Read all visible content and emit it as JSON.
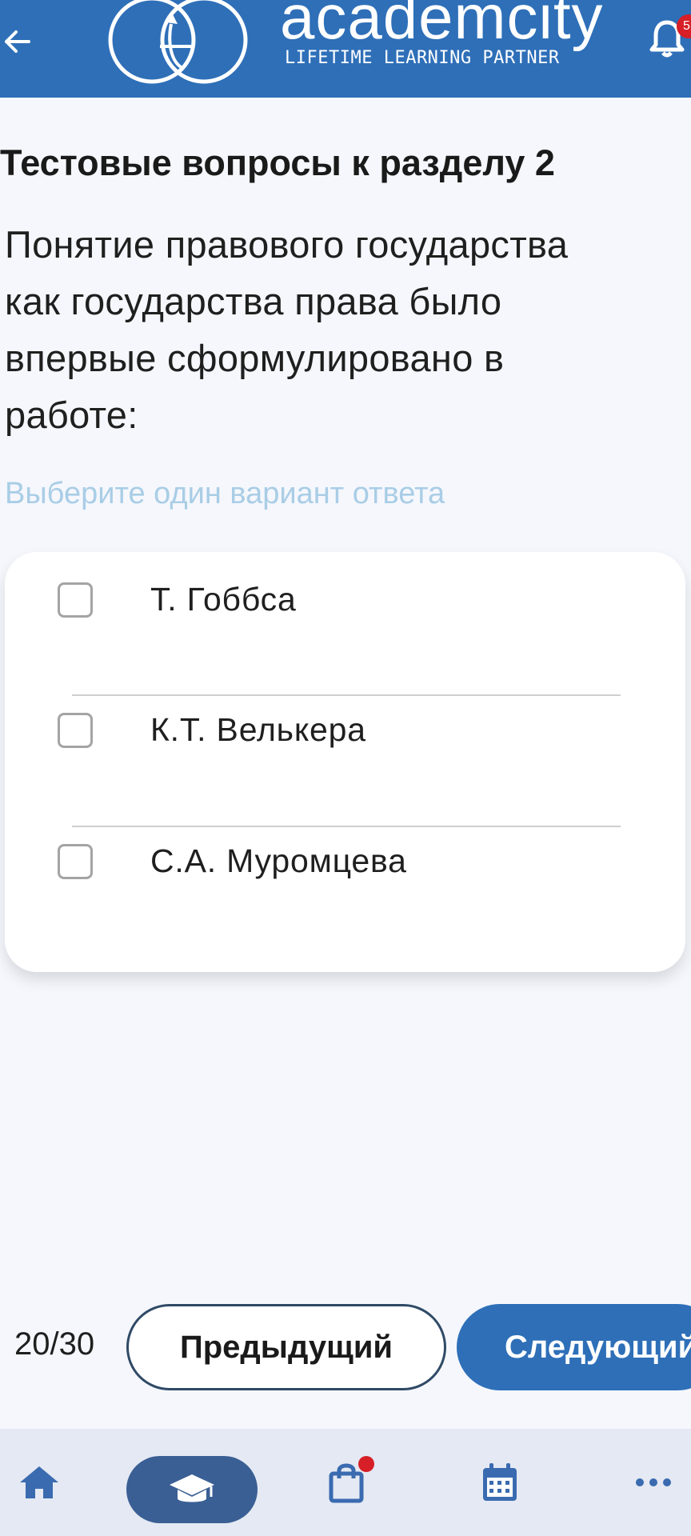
{
  "header": {
    "brand_name": "academcity",
    "brand_tagline": "LIFETIME LEARNING PARTNER",
    "notification_count": "5",
    "accent_color": "#2e6fb8"
  },
  "quiz": {
    "section_title": "Тестовые вопросы к разделу 2",
    "question_lines": [
      "Понятие правового государства",
      "как государства права было",
      "впервые сформулировано в",
      "работе:"
    ],
    "hint": "Выберите один вариант ответа",
    "options": [
      {
        "label": "Т. Гоббса",
        "checked": false
      },
      {
        "label": "К.Т. Велькера",
        "checked": false
      },
      {
        "label": "С.А. Муромцева",
        "checked": false
      }
    ]
  },
  "pager": {
    "counter": "20/30",
    "prev_label": "Предыдущий",
    "next_label": "Следующий"
  },
  "bottom_nav": {
    "items": [
      {
        "icon": "home-icon",
        "active": false
      },
      {
        "icon": "graduation-cap-icon",
        "active": true
      },
      {
        "icon": "shopping-bag-icon",
        "active": false,
        "has_badge": true
      },
      {
        "icon": "calendar-icon",
        "active": false
      },
      {
        "icon": "more-icon",
        "active": false
      }
    ]
  }
}
